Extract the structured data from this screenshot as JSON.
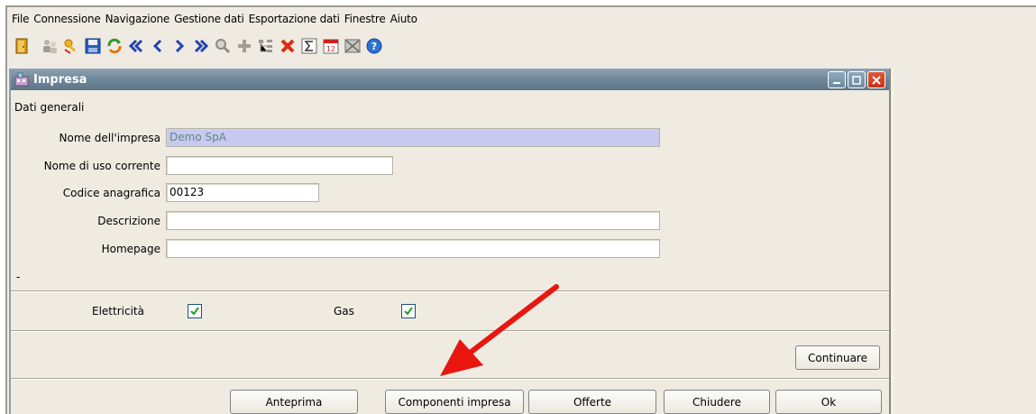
{
  "menu": [
    "File",
    "Connessione",
    "Navigazione",
    "Gestione dati",
    "Esportazione dati",
    "Finestre",
    "Aiuto"
  ],
  "toolbar_icons": [
    "exit-icon",
    "people-icon",
    "key-icon",
    "save-icon",
    "refresh-icon",
    "first-icon",
    "previous-icon",
    "next-icon",
    "last-icon",
    "search-icon",
    "add-icon",
    "tree-icon",
    "delete-icon",
    "sum-icon",
    "calendar-icon",
    "mail-icon",
    "help-icon"
  ],
  "window": {
    "title": "Impresa",
    "section": "Dati generali",
    "fields": {
      "nome_label": "Nome dell'impresa",
      "nome_value": "Demo SpA",
      "uso_label": "Nome di uso corrente",
      "uso_value": "",
      "codice_label": "Codice anagrafica",
      "codice_value": "00123",
      "descrizione_label": "Descrizione",
      "descrizione_value": "",
      "homepage_label": "Homepage",
      "homepage_value": ""
    },
    "dash": "-",
    "elettricita_label": "Elettricità",
    "elettricita_checked": true,
    "gas_label": "Gas",
    "gas_checked": true,
    "continue_label": "Continuare",
    "buttons": {
      "anteprima": "Anteprima",
      "componenti": "Componenti impresa",
      "offerte": "Offerte",
      "chiudere": "Chiudere",
      "ok": "Ok"
    }
  },
  "colors": {
    "titlebar": "#6f8799",
    "highlight_field": "#c8c9f1",
    "annotation_arrow": "#e8160f"
  }
}
